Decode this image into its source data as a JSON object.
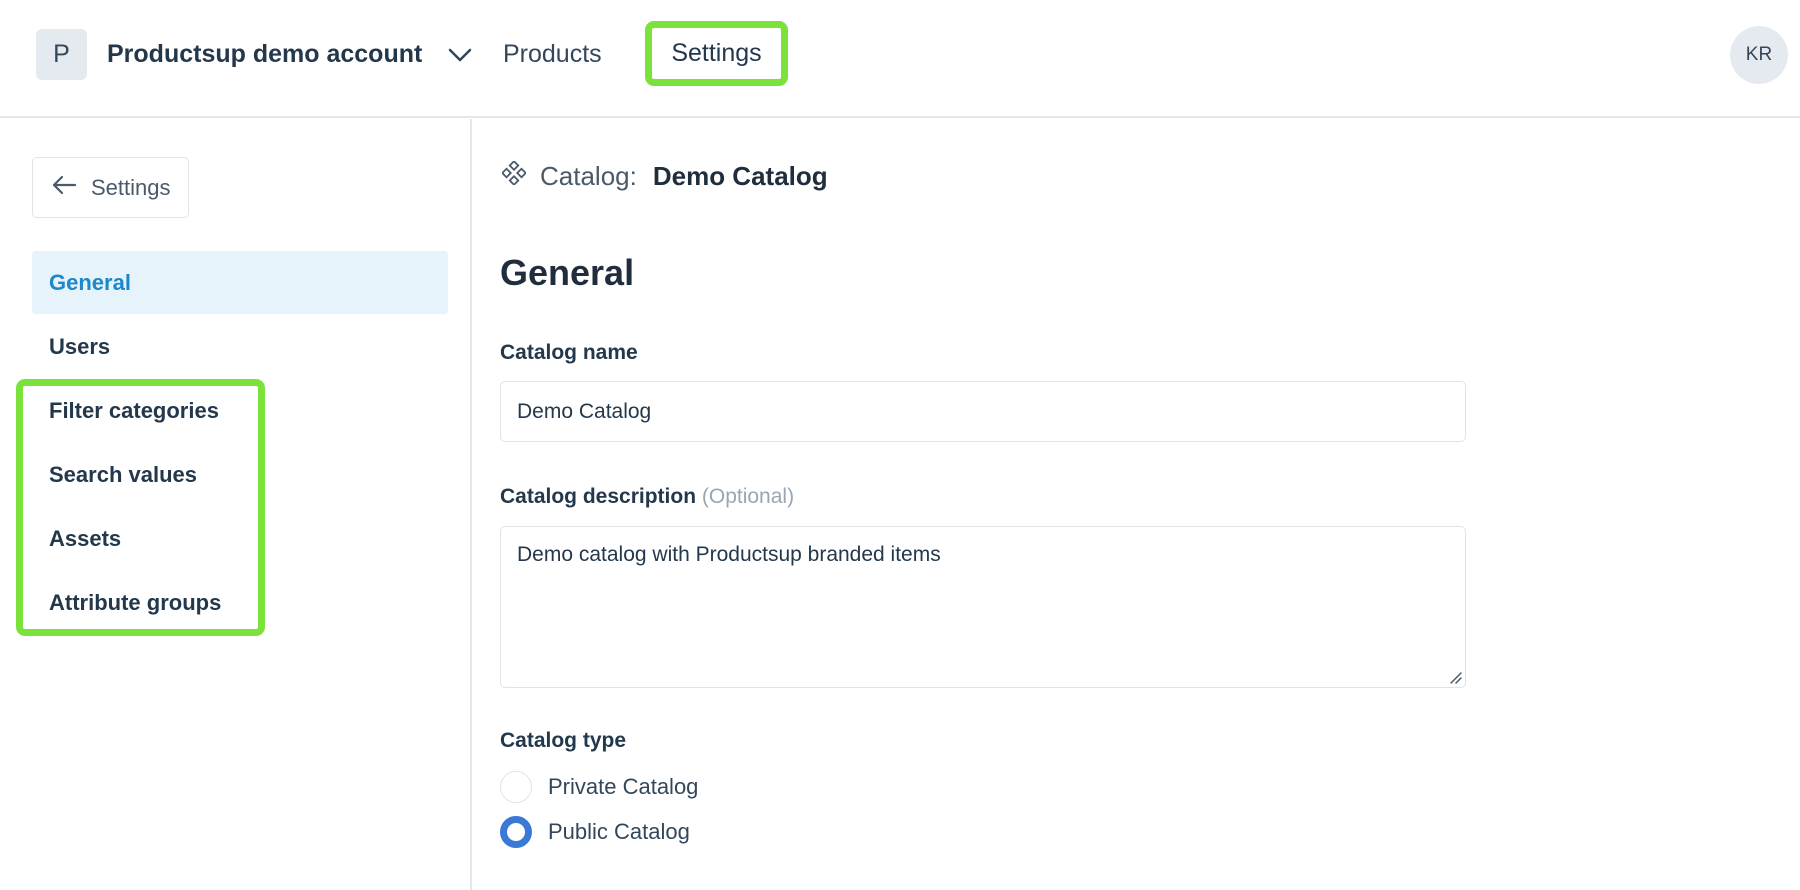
{
  "topbar": {
    "account_initial": "P",
    "account_name": "Productsup demo account",
    "nav_products": "Products",
    "nav_settings": "Settings",
    "user_initials": "KR"
  },
  "sidebar": {
    "back_label": "Settings",
    "items": [
      {
        "label": "General",
        "active": true
      },
      {
        "label": "Users"
      },
      {
        "label": "Filter categories"
      },
      {
        "label": "Search values"
      },
      {
        "label": "Assets"
      },
      {
        "label": "Attribute groups"
      }
    ]
  },
  "main": {
    "catalog_prefix": "Catalog:",
    "catalog_name": "Demo Catalog",
    "section_title": "General",
    "name_label": "Catalog name",
    "name_value": "Demo Catalog",
    "description_label": "Catalog description",
    "description_optional": "(Optional)",
    "description_value": "Demo catalog with Productsup branded items",
    "type_label": "Catalog type",
    "type_options": [
      {
        "label": "Private Catalog",
        "selected": false
      },
      {
        "label": "Public Catalog",
        "selected": true
      }
    ]
  },
  "colors": {
    "highlight": "#7be23c",
    "active_bg": "#e6f3fa",
    "active_text": "#1c87c9",
    "radio_checked": "#3b79d6"
  }
}
